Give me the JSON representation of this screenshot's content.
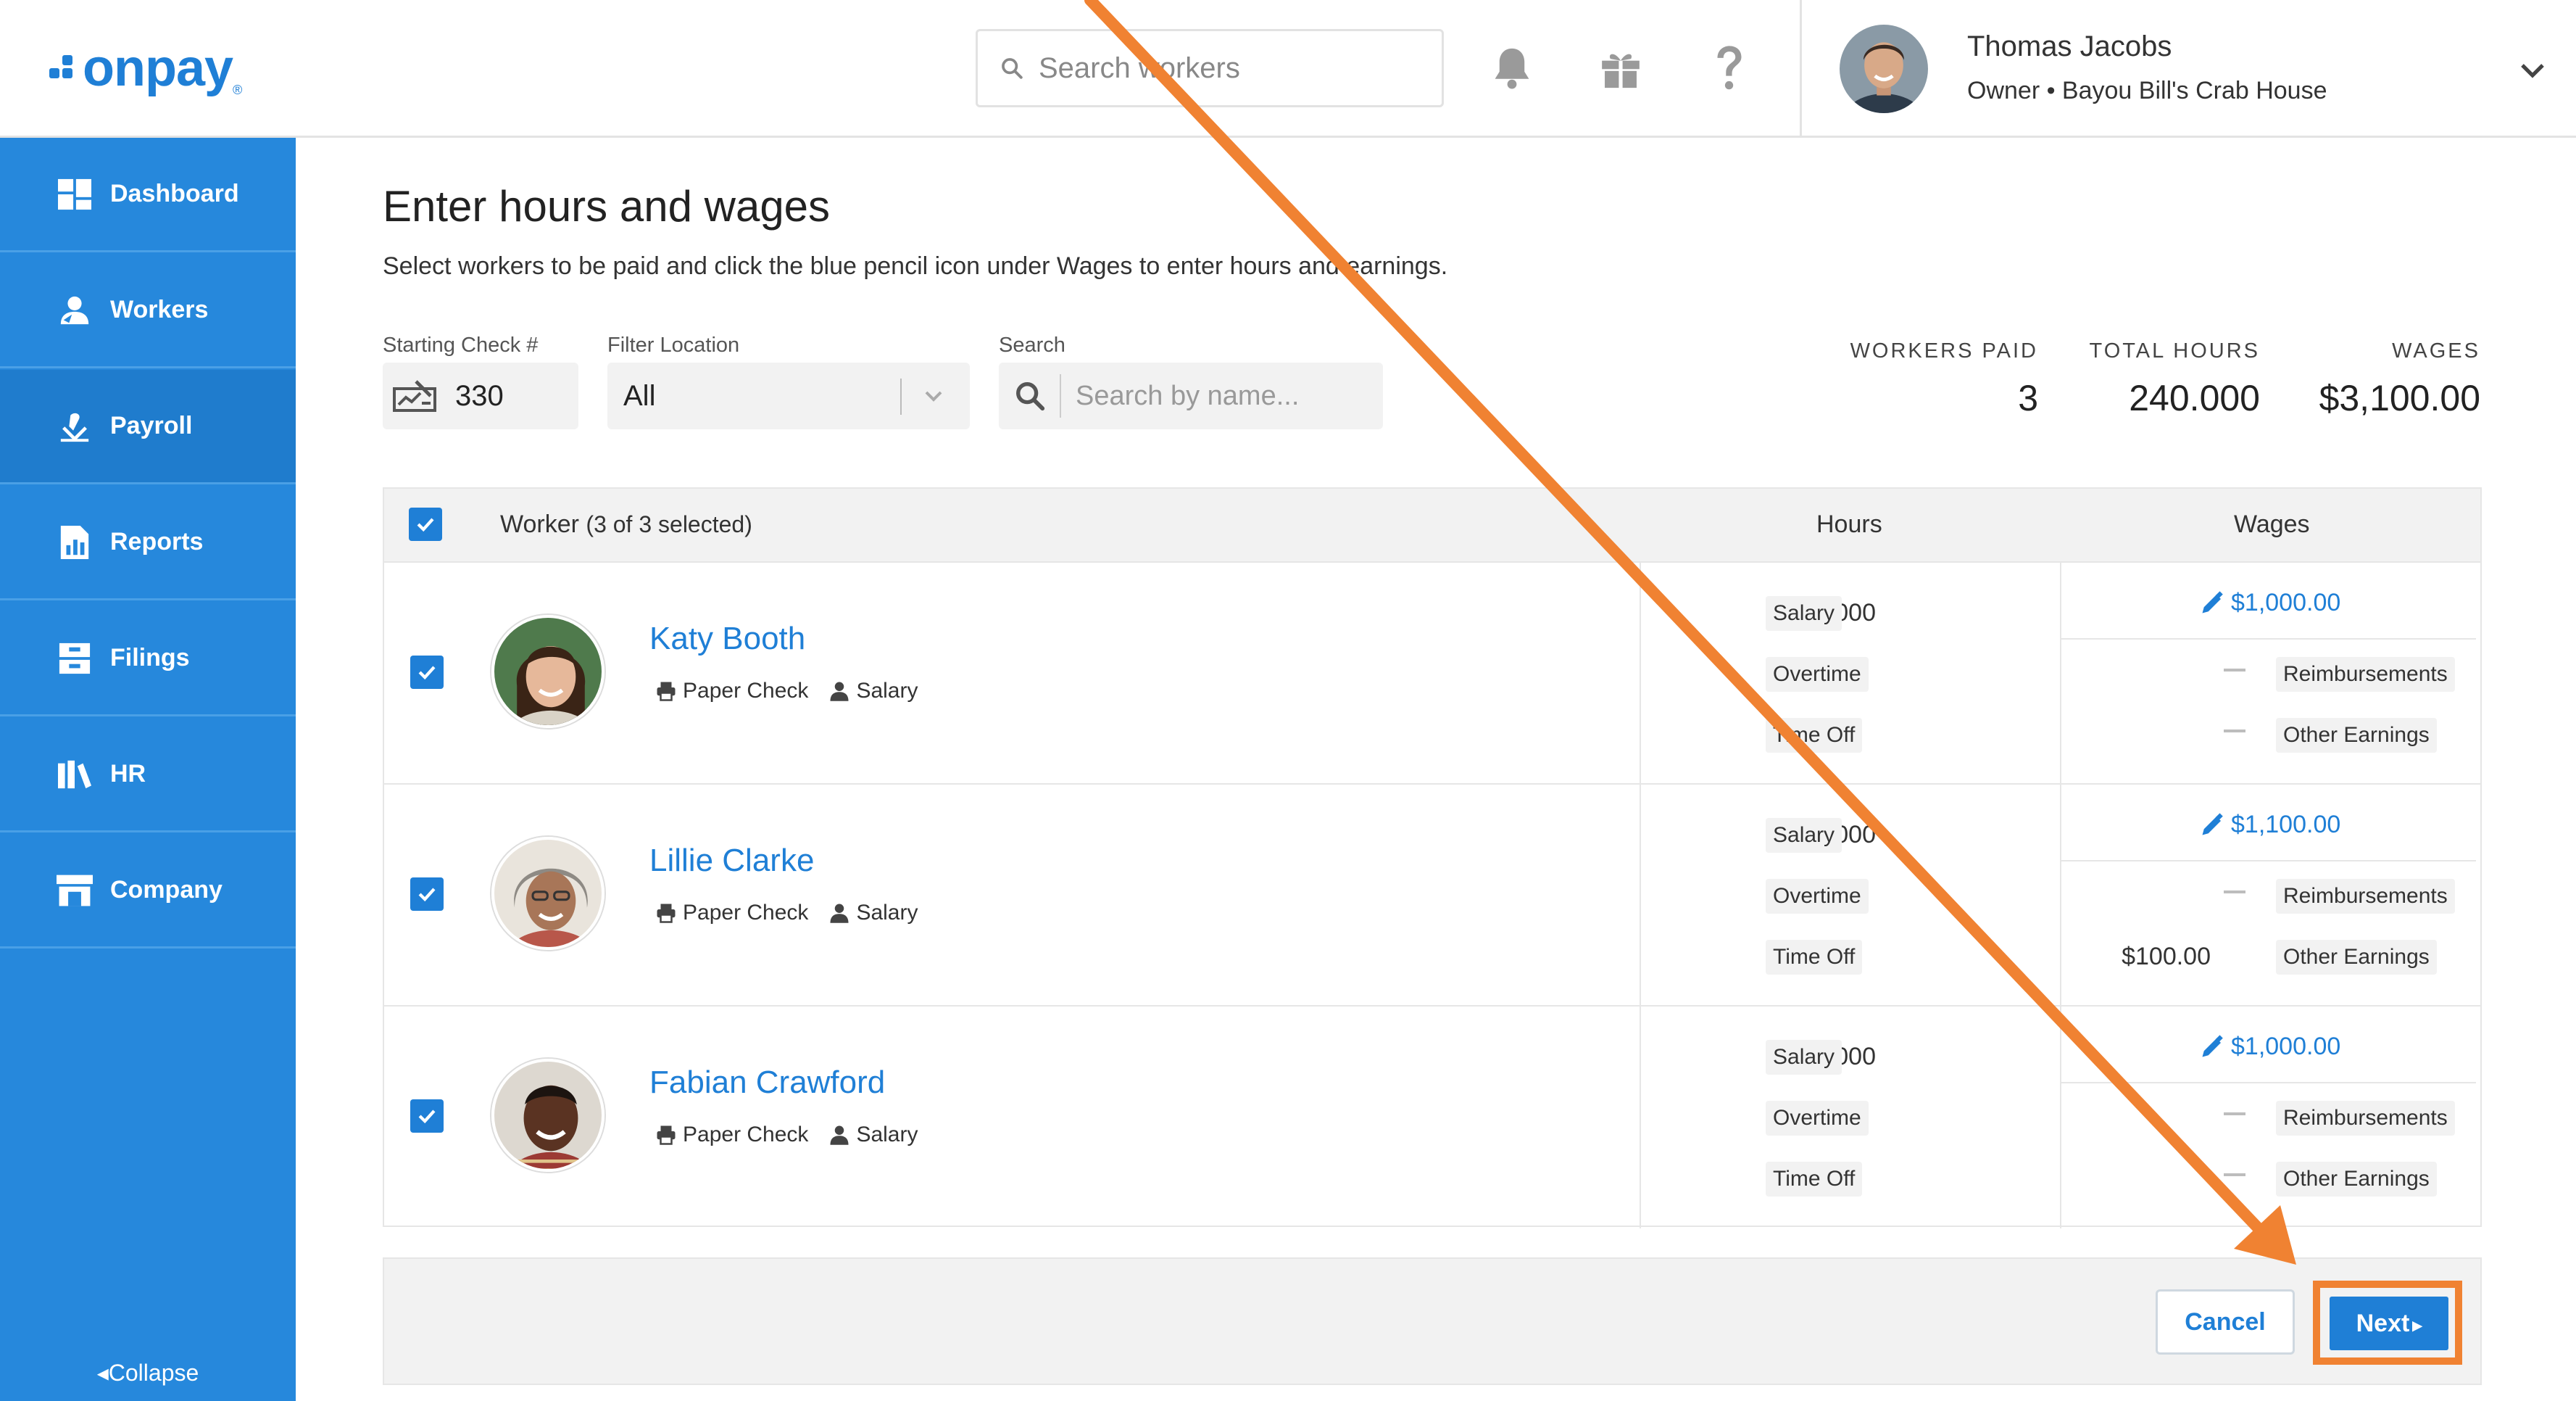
{
  "brand": {
    "name": "onpay",
    "registered": "®",
    "color": "#1f7fd6"
  },
  "header": {
    "search_placeholder": "Search workers",
    "user": {
      "name": "Thomas Jacobs",
      "role": "Owner • Bayou Bill's Crab House"
    }
  },
  "sidebar": {
    "items": [
      {
        "label": "Dashboard",
        "icon": "dashboard-icon"
      },
      {
        "label": "Workers",
        "icon": "workers-icon"
      },
      {
        "label": "Payroll",
        "icon": "payroll-icon",
        "active": true
      },
      {
        "label": "Reports",
        "icon": "reports-icon"
      },
      {
        "label": "Filings",
        "icon": "filings-icon"
      },
      {
        "label": "HR",
        "icon": "hr-icon"
      },
      {
        "label": "Company",
        "icon": "company-icon"
      }
    ],
    "collapse_label": "Collapse"
  },
  "page": {
    "title": "Enter hours and wages",
    "subtitle": "Select workers to be paid and click the blue pencil icon under Wages to enter hours and earnings."
  },
  "filters": {
    "starting_check_label": "Starting Check #",
    "starting_check_value": "330",
    "location_label": "Filter Location",
    "location_value": "All",
    "search_label": "Search",
    "search_placeholder": "Search by name..."
  },
  "stats": {
    "workers_paid_label": "WORKERS PAID",
    "workers_paid_value": "3",
    "total_hours_label": "TOTAL HOURS",
    "total_hours_value": "240.000",
    "wages_label": "WAGES",
    "wages_value": "$3,100.00"
  },
  "table": {
    "worker_header": "Worker",
    "selection_count": "(3 of 3 selected)",
    "hours_header": "Hours",
    "wages_header": "Wages",
    "hour_types": [
      "Salary",
      "Overtime",
      "Time Off"
    ],
    "wage_types": [
      "Reimbursements",
      "Other Earnings"
    ],
    "rows": [
      {
        "name": "Katy Booth",
        "payment": "Paper Check",
        "type": "Salary",
        "salary_hours": "80.000",
        "wage": "$1,000.00",
        "other_earnings": ""
      },
      {
        "name": "Lillie Clarke",
        "payment": "Paper Check",
        "type": "Salary",
        "salary_hours": "80.000",
        "wage": "$1,100.00",
        "other_earnings": "$100.00"
      },
      {
        "name": "Fabian Crawford",
        "payment": "Paper Check",
        "type": "Salary",
        "salary_hours": "80.000",
        "wage": "$1,000.00",
        "other_earnings": ""
      }
    ]
  },
  "footer": {
    "cancel_label": "Cancel",
    "next_label": "Next"
  },
  "colors": {
    "accent": "#1f7fd6",
    "sidebar": "#2688dc",
    "highlight": "#f08232"
  }
}
